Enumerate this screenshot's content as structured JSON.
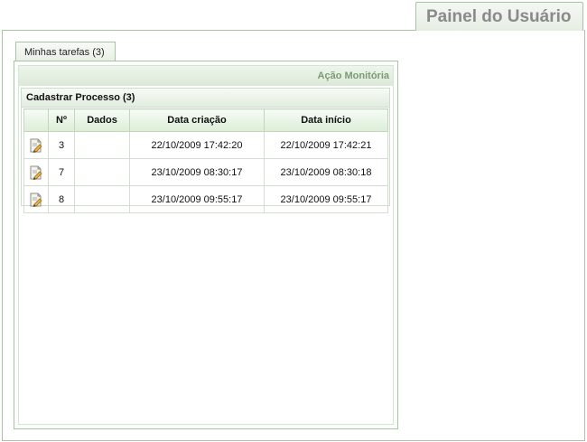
{
  "header": {
    "title": "Painel do Usuário"
  },
  "tabs": [
    {
      "label": "Minhas tarefas (3)"
    }
  ],
  "action_bar": {
    "label": "Ação Monitória"
  },
  "group": {
    "title": "Cadastrar Processo (3)"
  },
  "table": {
    "columns": [
      "",
      "Nº",
      "Dados",
      "Data criação",
      "Data início"
    ],
    "rows": [
      {
        "icon": "edit-document-icon",
        "num": "3",
        "dados": "",
        "criacao": "22/10/2009 17:42:20",
        "inicio": "22/10/2009 17:42:21"
      },
      {
        "icon": "edit-document-icon",
        "num": "7",
        "dados": "",
        "criacao": "23/10/2009 08:30:17",
        "inicio": "23/10/2009 08:30:18"
      },
      {
        "icon": "edit-document-icon",
        "num": "8",
        "dados": "",
        "criacao": "23/10/2009 09:55:17",
        "inicio": "23/10/2009 09:55:17"
      }
    ]
  }
}
